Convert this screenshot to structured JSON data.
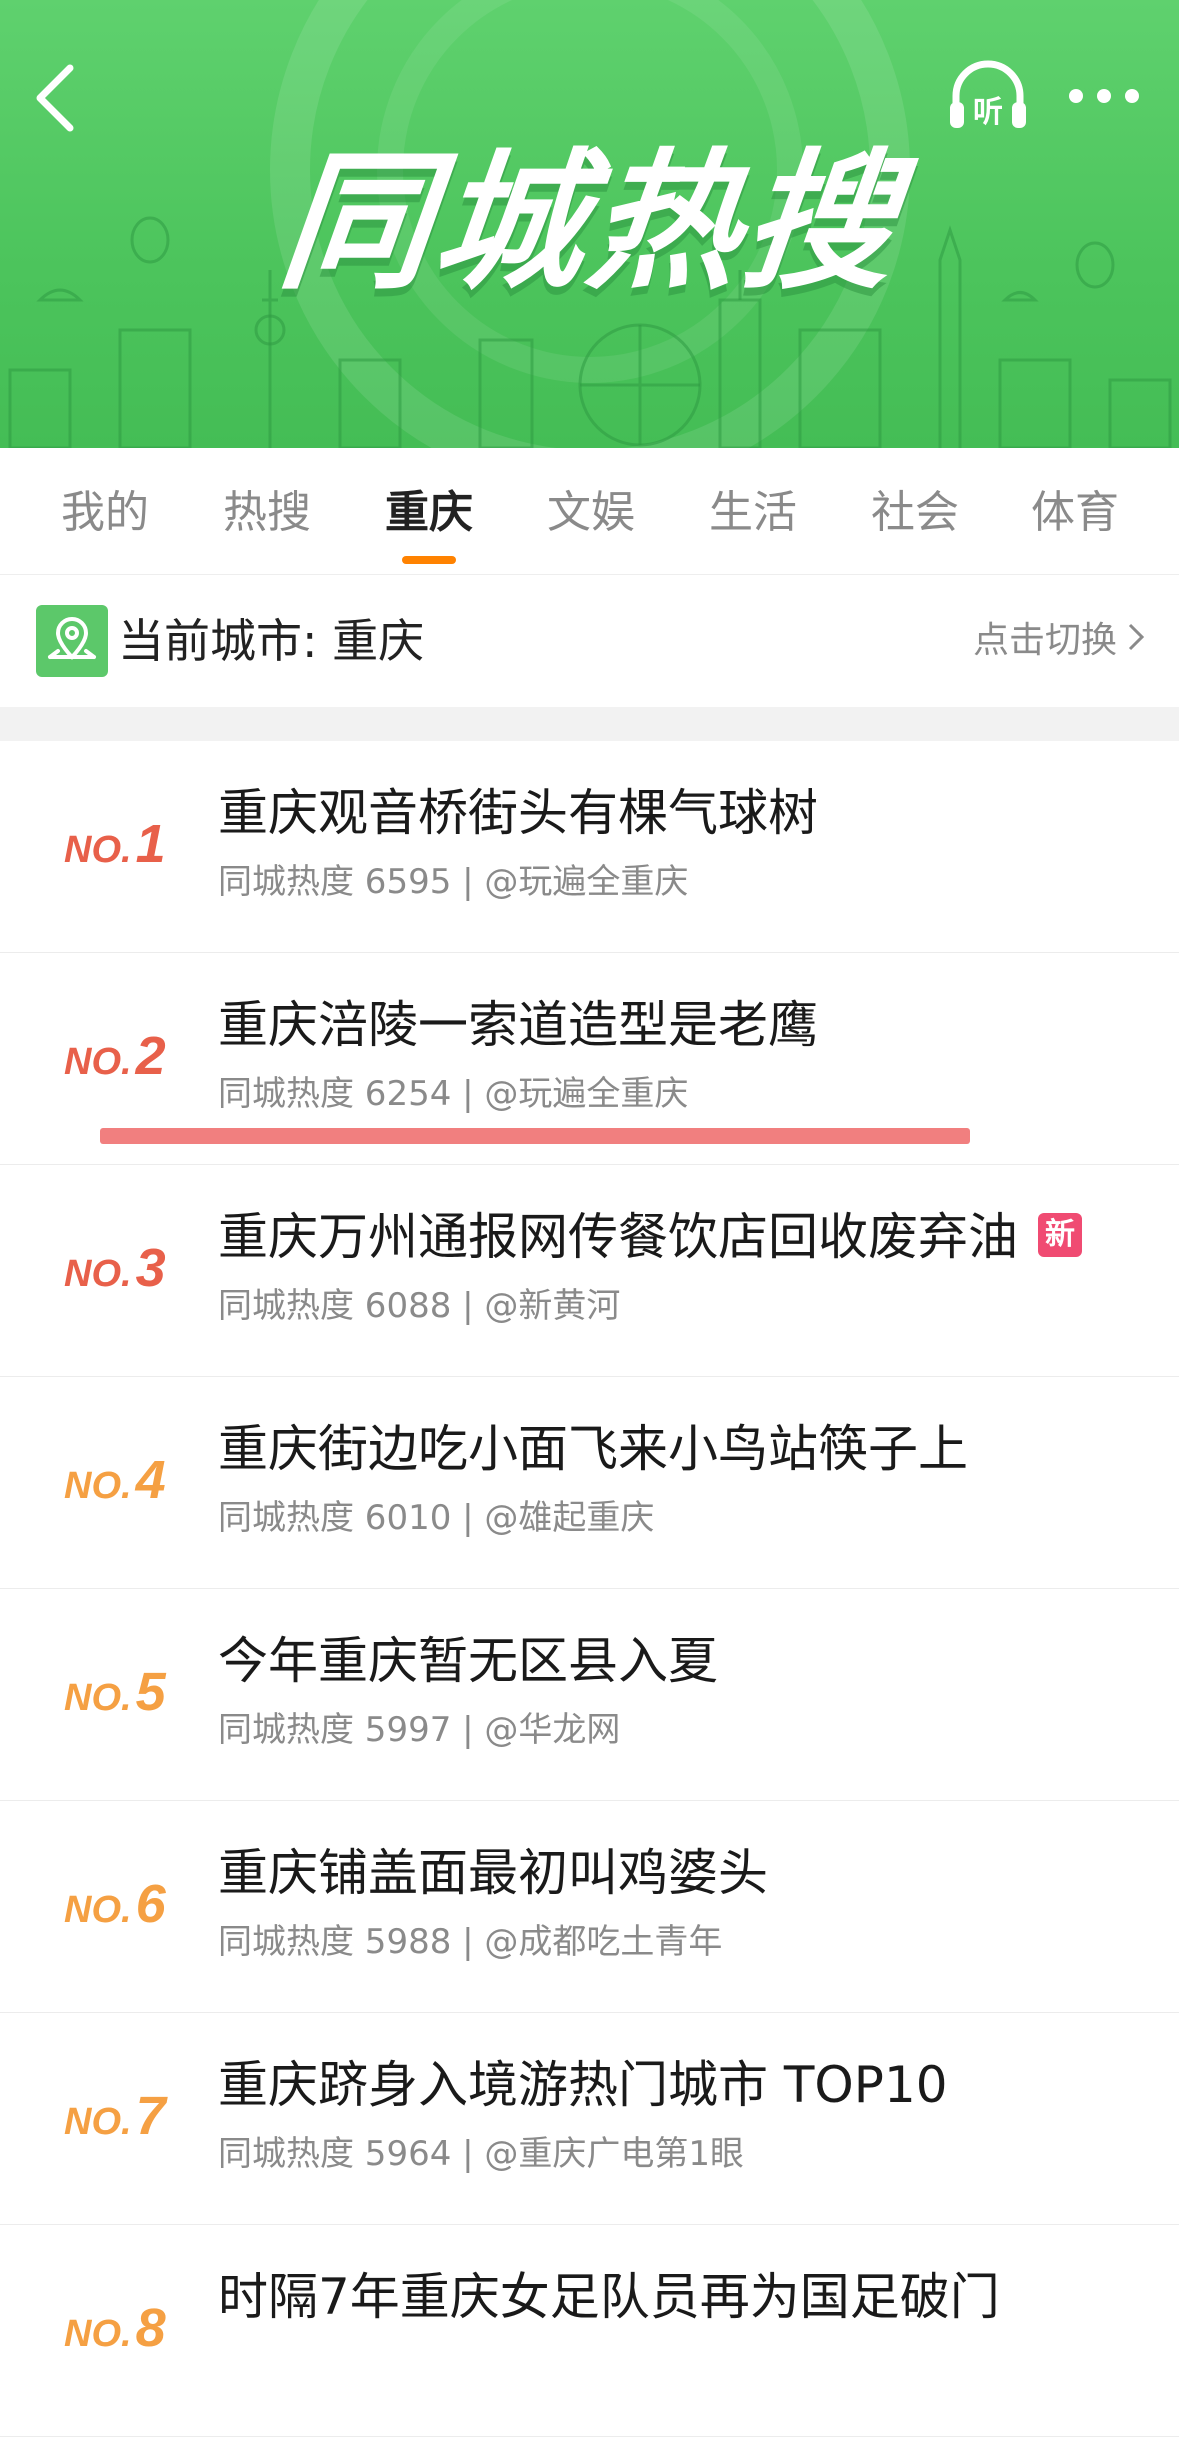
{
  "banner": {
    "title": "同城热搜",
    "listen_label": "听",
    "color": "#4cc45c"
  },
  "tabs": [
    {
      "label": "我的",
      "active": false
    },
    {
      "label": "热搜",
      "active": false
    },
    {
      "label": "重庆",
      "active": true
    },
    {
      "label": "文娱",
      "active": false
    },
    {
      "label": "生活",
      "active": false
    },
    {
      "label": "社会",
      "active": false
    },
    {
      "label": "体育",
      "active": false
    }
  ],
  "city": {
    "label": "当前城市: 重庆",
    "switch_label": "点击切换"
  },
  "items": [
    {
      "rank_no": "NO.",
      "rank": "1",
      "rank_color": "#e8604a",
      "title": "重庆观音桥街头有棵气球树",
      "meta": "同城热度 6595 | @玩遍全重庆",
      "badge": ""
    },
    {
      "rank_no": "NO.",
      "rank": "2",
      "rank_color": "#e8604a",
      "title": "重庆涪陵一索道造型是老鹰",
      "meta": "同城热度 6254 | @玩遍全重庆",
      "badge": ""
    },
    {
      "rank_no": "NO.",
      "rank": "3",
      "rank_color": "#e8604a",
      "title": "重庆万州通报网传餐饮店回收废弃油",
      "meta": "同城热度 6088 | @新黄河",
      "badge": "新"
    },
    {
      "rank_no": "NO.",
      "rank": "4",
      "rank_color": "#f5a043",
      "title": "重庆街边吃小面飞来小鸟站筷子上",
      "meta": "同城热度 6010 | @雄起重庆",
      "badge": ""
    },
    {
      "rank_no": "NO.",
      "rank": "5",
      "rank_color": "#f5a043",
      "title": "今年重庆暂无区县入夏",
      "meta": "同城热度 5997 | @华龙网",
      "badge": ""
    },
    {
      "rank_no": "NO.",
      "rank": "6",
      "rank_color": "#f5a043",
      "title": "重庆铺盖面最初叫鸡婆头",
      "meta": "同城热度 5988 | @成都吃土青年",
      "badge": ""
    },
    {
      "rank_no": "NO.",
      "rank": "7",
      "rank_color": "#f5a043",
      "title": "重庆跻身入境游热门城市 TOP10",
      "meta": "同城热度 5964 | @重庆广电第1眼",
      "badge": ""
    },
    {
      "rank_no": "NO.",
      "rank": "8",
      "rank_color": "#f5a043",
      "title": "时隔7年重庆女足队员再为国足破门",
      "meta": "",
      "badge": ""
    }
  ]
}
